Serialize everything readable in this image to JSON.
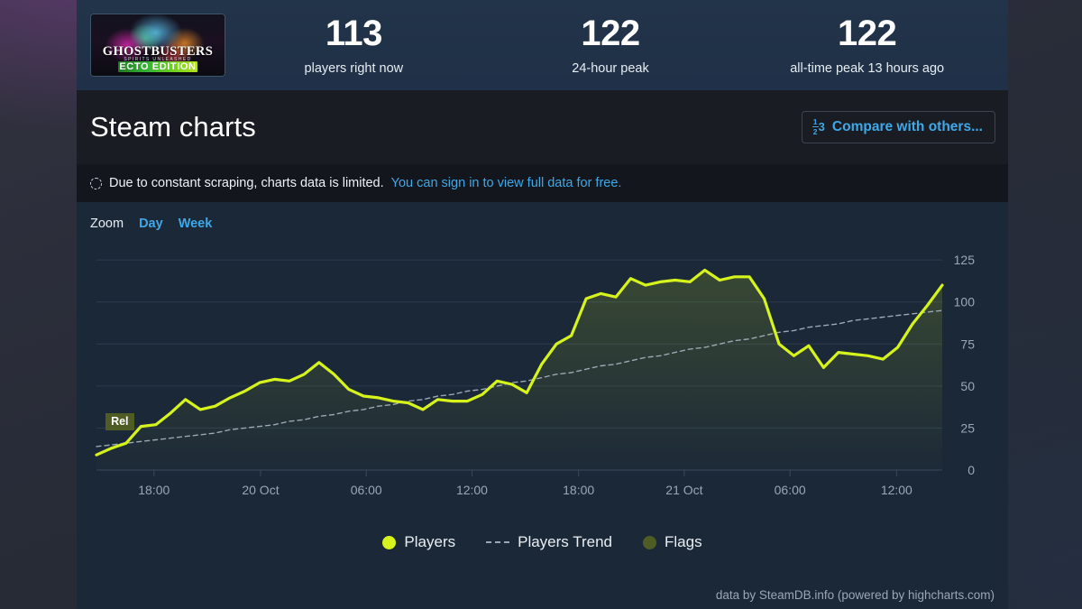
{
  "game": {
    "title": "GHOSTBUSTERS",
    "subtitle": "SPIRITS UNLEASHED",
    "edition": "ECTO EDITION"
  },
  "stats": [
    {
      "value": "113",
      "label": "players right now"
    },
    {
      "value": "122",
      "label": "24-hour peak"
    },
    {
      "value": "122",
      "label": "all-time peak 13 hours ago"
    }
  ],
  "header": {
    "page_title": "Steam charts",
    "compare_button": "Compare with others...",
    "compare_icon": "fraction-ranking-icon"
  },
  "notice": {
    "icon": "spinner-icon",
    "text": "Due to constant scraping, charts data is limited.",
    "link": "You can sign in to view full data for free."
  },
  "zoom_controls": {
    "label": "Zoom",
    "options": [
      "Day",
      "Week"
    ]
  },
  "flags": [
    {
      "label": "Rel",
      "x_fraction": 0.015,
      "color": "#4f5d24"
    }
  ],
  "credit": "data by SteamDB.info (powered by highcharts.com)",
  "colors": {
    "players_line": "#d6f31c",
    "trend_line": "#9aa7b4",
    "flag": "#4f5d24",
    "panel_bg": "#1b2838",
    "title_bg": "#191c22",
    "notice_bg": "#13161c",
    "accent_link": "#3fa8e8",
    "gridline": "#2c3a4c"
  },
  "chart_data": {
    "type": "line",
    "title": "Steam charts",
    "xlabel": "",
    "ylabel": "",
    "ylim": [
      0,
      131
    ],
    "yticks": [
      0,
      25,
      50,
      75,
      100,
      125
    ],
    "grid": true,
    "legend_position": "bottom",
    "xticklabels": [
      "18:00",
      "20 Oct",
      "06:00",
      "12:00",
      "18:00",
      "21 Oct",
      "06:00",
      "12:00"
    ],
    "xtick_fractions": [
      0.068,
      0.194,
      0.319,
      0.444,
      0.57,
      0.695,
      0.82,
      0.946
    ],
    "series": [
      {
        "name": "Players",
        "color": "#d6f31c",
        "style": "solid",
        "values": [
          9,
          13,
          16,
          26,
          27,
          34,
          42,
          36,
          38,
          43,
          47,
          52,
          54,
          53,
          57,
          64,
          57,
          48,
          44,
          43,
          41,
          40,
          36,
          42,
          41,
          41,
          45,
          53,
          51,
          46,
          63,
          75,
          80,
          102,
          105,
          103,
          114,
          110,
          112,
          113,
          112,
          119,
          113,
          115,
          115,
          102,
          75,
          68,
          74,
          61,
          70,
          69,
          68,
          66,
          73,
          87,
          98,
          110
        ]
      },
      {
        "name": "Players Trend",
        "color": "#9aa7b4",
        "style": "dashed",
        "values": [
          14,
          15,
          16,
          17,
          18,
          19,
          20,
          21,
          22,
          24,
          25,
          26,
          27,
          29,
          30,
          32,
          33,
          35,
          36,
          38,
          39,
          41,
          42,
          44,
          45,
          47,
          48,
          50,
          52,
          53,
          55,
          57,
          58,
          60,
          62,
          63,
          65,
          67,
          68,
          70,
          72,
          73,
          75,
          77,
          78,
          80,
          82,
          83,
          85,
          86,
          87,
          89,
          90,
          91,
          92,
          93,
          94,
          95
        ]
      },
      {
        "name": "Flags",
        "color": "#4f5d24",
        "style": "marker",
        "values": []
      }
    ]
  }
}
